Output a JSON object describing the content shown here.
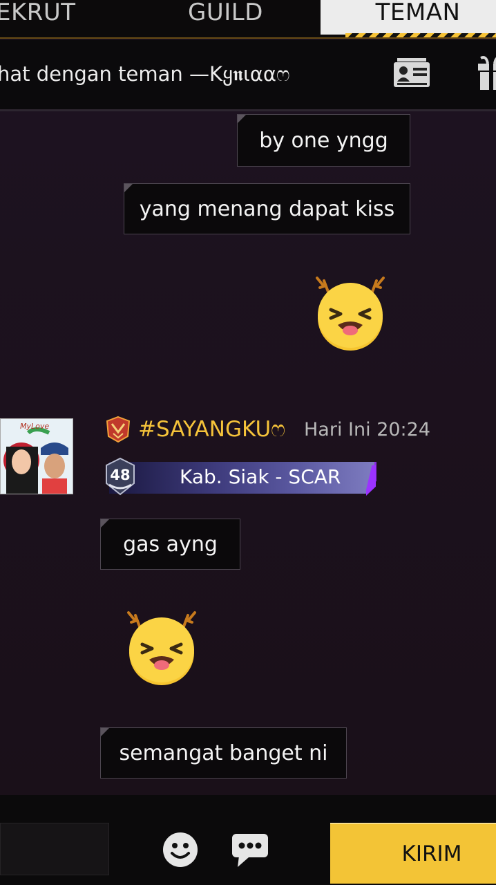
{
  "tabs": {
    "rekrut": "EKRUT",
    "guild": "GUILD",
    "teman": "TEMAN"
  },
  "header": {
    "title": "hat dengan teman —Kყ𝖓ιααෆ",
    "profile_icon": "profile-card-icon",
    "gift_icon": "gift-icon"
  },
  "messages": [
    {
      "type": "text",
      "side": "right",
      "text": "by one yngg"
    },
    {
      "type": "text",
      "side": "right",
      "text": "yang menang dapat kiss"
    },
    {
      "type": "sticker",
      "side": "right",
      "icon": "laughing-deer-emoji-icon"
    },
    {
      "type": "sender",
      "name": "#SAYANGKUෆ",
      "time": "Hari Ini 20:24",
      "level": "48",
      "banner": "Kab. Siak - SCAR"
    },
    {
      "type": "text",
      "side": "left",
      "text": "gas ayng"
    },
    {
      "type": "sticker",
      "side": "left",
      "icon": "laughing-deer-emoji-icon"
    },
    {
      "type": "text",
      "side": "left",
      "text": "semangat banget ni"
    }
  ],
  "avatar": {
    "caption": "MyLove"
  },
  "bottom": {
    "input_value": "",
    "send_label": "KIRIM",
    "emoji_icon": "smiley-icon",
    "quick_icon": "speech-bubble-icon"
  },
  "colors": {
    "accent": "#f3c436",
    "sender_name": "#f5c33a",
    "bubble_bg": "#0b090b",
    "background": "#1a1019"
  }
}
